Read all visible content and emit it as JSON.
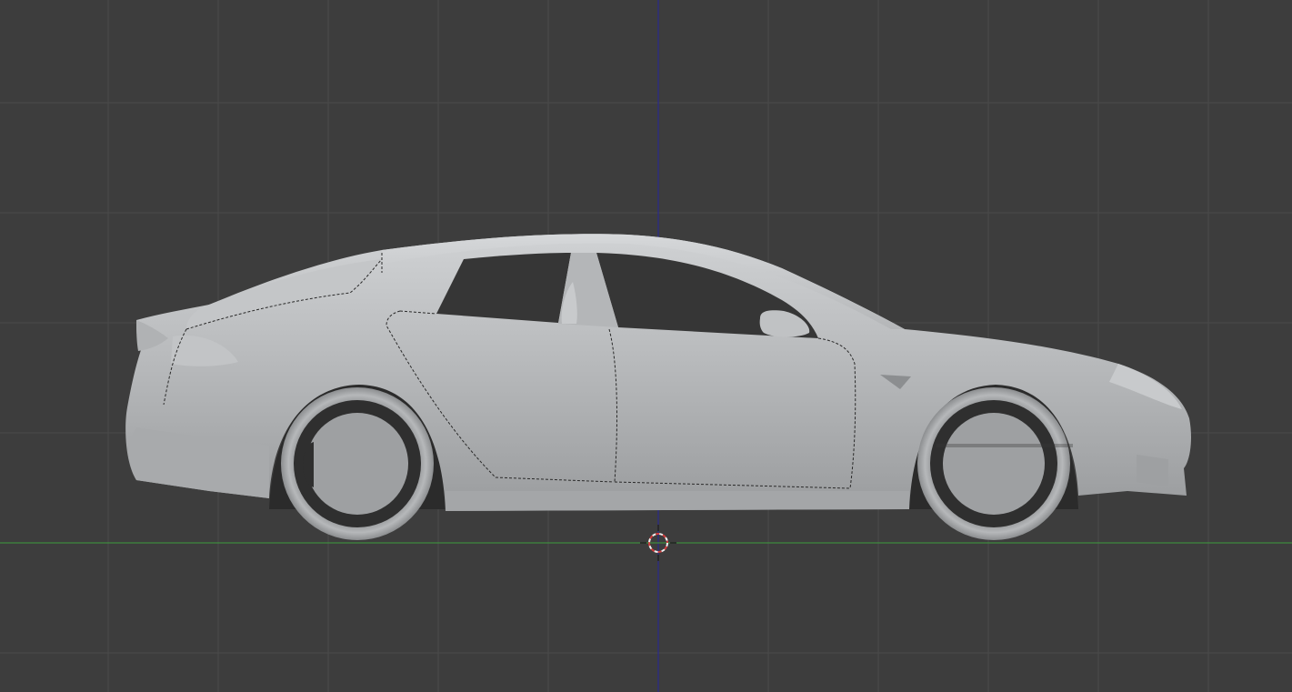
{
  "viewport": {
    "view": "side-orthographic",
    "model": "car-sedan",
    "shading": "solid",
    "colors": {
      "background": "#3d3d3d",
      "grid_minor": "#434343",
      "grid_major": "#4a4a4a",
      "axis_y": "#2a2a8c",
      "axis_z": "#3e8a3e",
      "body_light": "#c8cacc",
      "body_mid": "#acaeb0",
      "body_dark": "#8a8c8e",
      "outline": "#2a2a2a",
      "cursor_red": "#d23c3c",
      "cursor_white": "#f0f0f0"
    },
    "icons": {
      "cursor": "3d-cursor-icon",
      "origin": "world-origin-icon"
    }
  }
}
